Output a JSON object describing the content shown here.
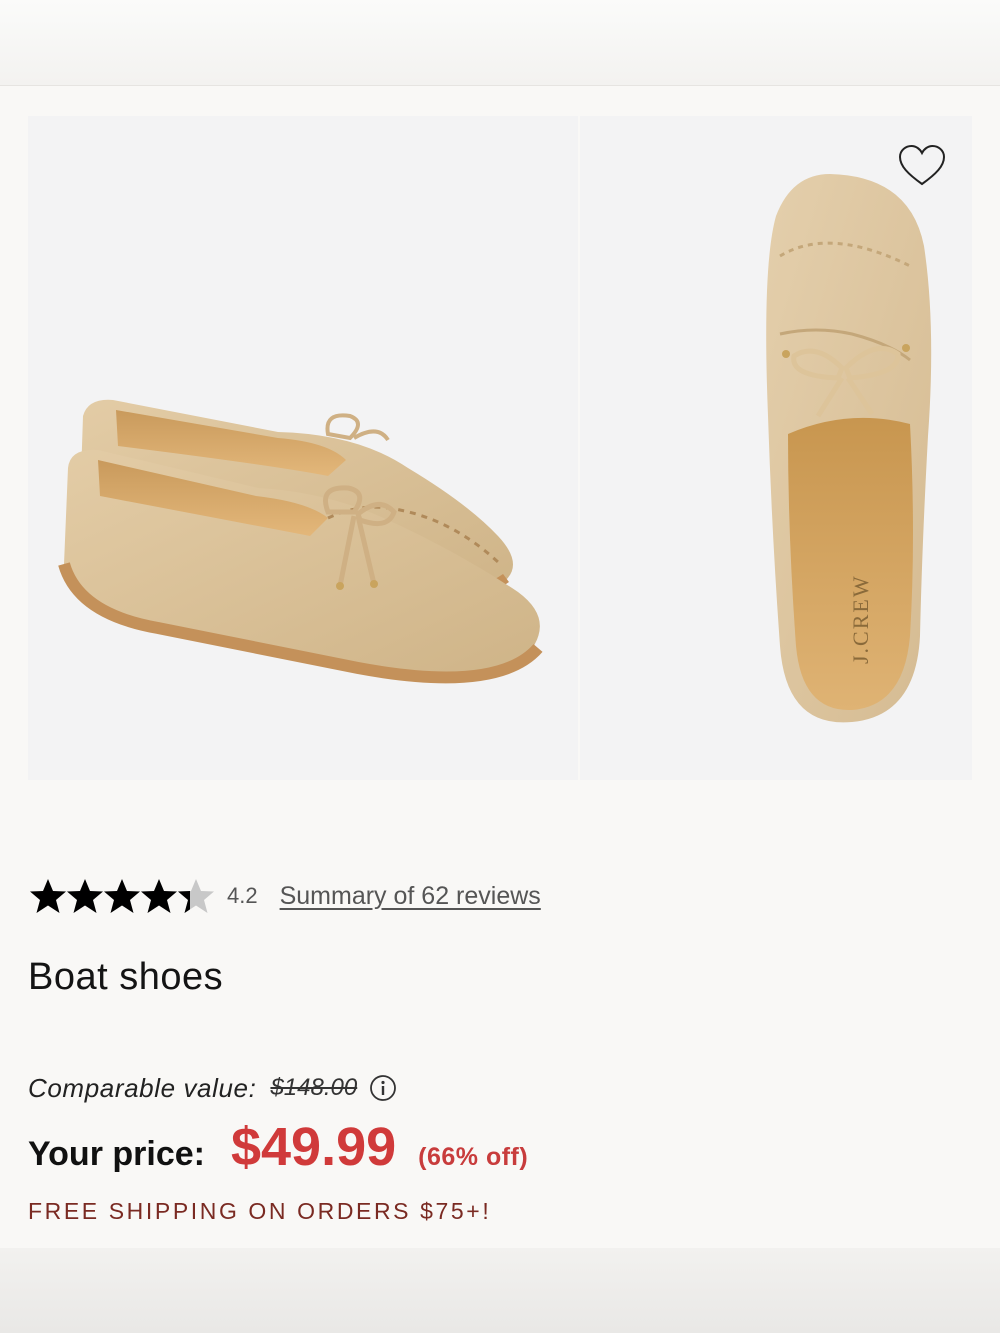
{
  "product": {
    "name": "Boat shoes",
    "rating": "4.2",
    "stars_filled": 4.2,
    "stars_total": 5,
    "reviews_link": "Summary of 62 reviews",
    "comparable_label": "Comparable value:",
    "comparable_value": "$148.00",
    "price_label": "Your price:",
    "price": "$49.99",
    "discount": "(66% off)",
    "shipping_note": "FREE SHIPPING ON ORDERS $75+!",
    "brand_mark": "J.CREW"
  },
  "icons": {
    "favorite": "heart-outline-icon",
    "info": "info-circle-icon",
    "star": "star-icon"
  },
  "colors": {
    "price": "#d03a3a",
    "shipping": "#7a2a22",
    "shoe": "#dcc49c",
    "background": "#f9f8f6"
  }
}
